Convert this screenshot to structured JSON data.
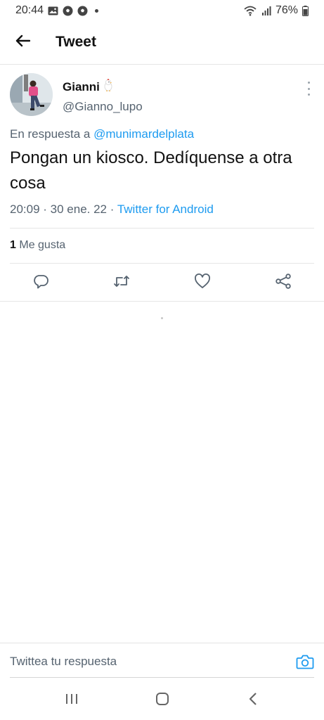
{
  "status_bar": {
    "time": "20:44",
    "battery": "76%"
  },
  "app_bar": {
    "title": "Tweet"
  },
  "tweet": {
    "author": {
      "display_name": "Gianni",
      "handle": "@Gianno_lupo"
    },
    "reply_prefix": "En respuesta a",
    "reply_mention": "@munimardelplata",
    "text": "Pongan un kiosco. Dedíquense a otra cosa",
    "timestamp": "20:09 · 30 ene. 22 ·",
    "source": "Twitter for Android",
    "likes_count": "1",
    "likes_label": "Me gusta"
  },
  "composer": {
    "placeholder": "Twittea tu respuesta"
  },
  "colors": {
    "accent": "#1d9bf0",
    "secondary_text": "#566370",
    "primary_text": "#111111"
  },
  "icons": {
    "back": "arrow-left-icon",
    "more": "more-vertical-icon",
    "reply": "reply-icon",
    "retweet": "retweet-icon",
    "like": "heart-icon",
    "share": "share-icon",
    "camera": "camera-icon"
  }
}
